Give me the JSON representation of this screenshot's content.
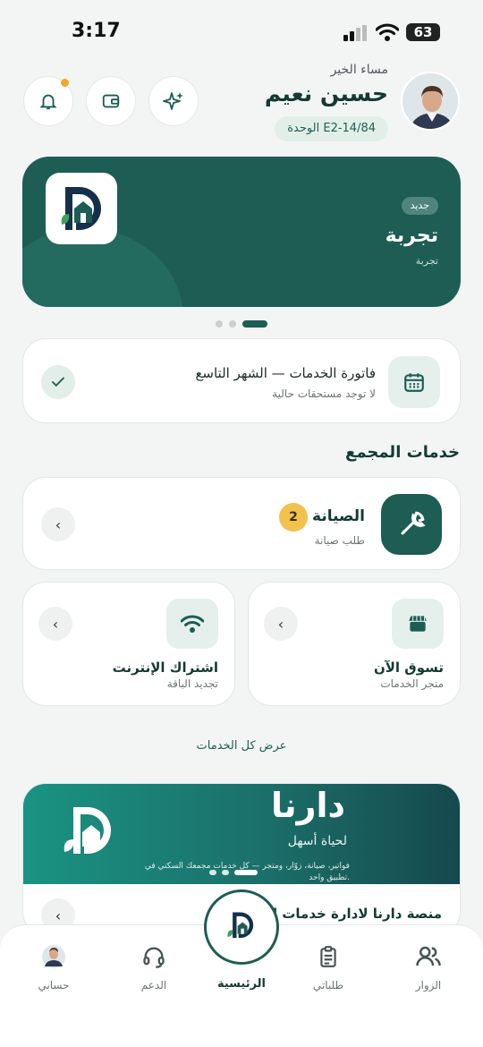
{
  "status_bar": {
    "time": "3:17",
    "battery": "63"
  },
  "header": {
    "greeting": "مساء الخير",
    "user_name": "حسين نعيم",
    "unit": "الوحدة E2-14/84"
  },
  "hero": {
    "badge": "جديد",
    "title": "تجربة",
    "subtitle": "تجربة"
  },
  "bill": {
    "title": "فاتورة الخدمات — الشهر التاسع",
    "subtitle": "لا توجد مستحقات حالية"
  },
  "section_title": "خدمات المجمع",
  "maintenance": {
    "title": "الصيانة",
    "count": "2",
    "subtitle": "طلب صيانة"
  },
  "services": [
    {
      "title": "تسوق الآن",
      "subtitle": "متجر الخدمات"
    },
    {
      "title": "اشتراك الإنترنت",
      "subtitle": "تجديد الباقة"
    }
  ],
  "view_all": "عرض كل الخدمات",
  "promo": {
    "brand": "دارنا",
    "tagline": "لحياة أسهل",
    "description": "فواتير، صيانة، زوّار، ومتجر — كل خدمات مجمعك السكني في تطبيق واحد.",
    "title": "منصة دارنا لادارة خدمات الـ ...نية"
  },
  "tabs": {
    "account": "حسابي",
    "support": "الدعم",
    "home": "الرئيسية",
    "requests": "طلباتي",
    "visitors": "الزوار"
  },
  "colors": {
    "primary": "#1d5d53",
    "accent": "#f2c14e",
    "background": "#f3f5f4"
  }
}
